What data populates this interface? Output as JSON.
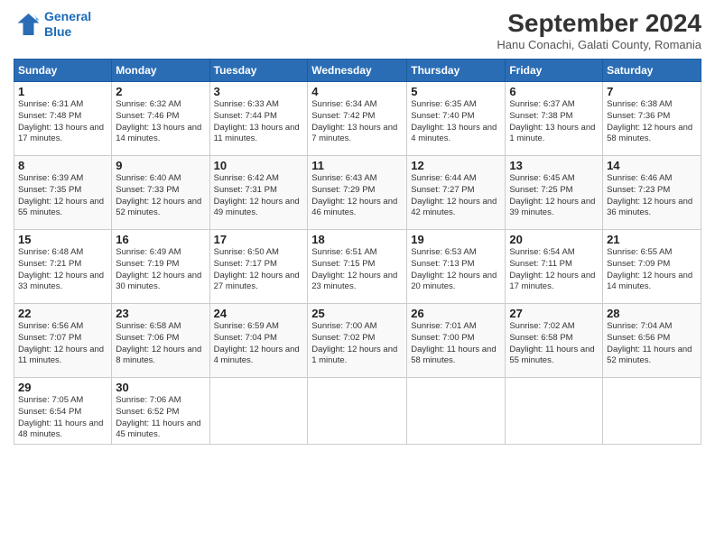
{
  "header": {
    "logo_line1": "General",
    "logo_line2": "Blue",
    "month_title": "September 2024",
    "subtitle": "Hanu Conachi, Galati County, Romania"
  },
  "weekdays": [
    "Sunday",
    "Monday",
    "Tuesday",
    "Wednesday",
    "Thursday",
    "Friday",
    "Saturday"
  ],
  "weeks": [
    [
      {
        "day": 1,
        "sunrise": "6:31 AM",
        "sunset": "7:48 PM",
        "daylight": "13 hours and 17 minutes."
      },
      {
        "day": 2,
        "sunrise": "6:32 AM",
        "sunset": "7:46 PM",
        "daylight": "13 hours and 14 minutes."
      },
      {
        "day": 3,
        "sunrise": "6:33 AM",
        "sunset": "7:44 PM",
        "daylight": "13 hours and 11 minutes."
      },
      {
        "day": 4,
        "sunrise": "6:34 AM",
        "sunset": "7:42 PM",
        "daylight": "13 hours and 7 minutes."
      },
      {
        "day": 5,
        "sunrise": "6:35 AM",
        "sunset": "7:40 PM",
        "daylight": "13 hours and 4 minutes."
      },
      {
        "day": 6,
        "sunrise": "6:37 AM",
        "sunset": "7:38 PM",
        "daylight": "13 hours and 1 minute."
      },
      {
        "day": 7,
        "sunrise": "6:38 AM",
        "sunset": "7:36 PM",
        "daylight": "12 hours and 58 minutes."
      }
    ],
    [
      {
        "day": 8,
        "sunrise": "6:39 AM",
        "sunset": "7:35 PM",
        "daylight": "12 hours and 55 minutes."
      },
      {
        "day": 9,
        "sunrise": "6:40 AM",
        "sunset": "7:33 PM",
        "daylight": "12 hours and 52 minutes."
      },
      {
        "day": 10,
        "sunrise": "6:42 AM",
        "sunset": "7:31 PM",
        "daylight": "12 hours and 49 minutes."
      },
      {
        "day": 11,
        "sunrise": "6:43 AM",
        "sunset": "7:29 PM",
        "daylight": "12 hours and 46 minutes."
      },
      {
        "day": 12,
        "sunrise": "6:44 AM",
        "sunset": "7:27 PM",
        "daylight": "12 hours and 42 minutes."
      },
      {
        "day": 13,
        "sunrise": "6:45 AM",
        "sunset": "7:25 PM",
        "daylight": "12 hours and 39 minutes."
      },
      {
        "day": 14,
        "sunrise": "6:46 AM",
        "sunset": "7:23 PM",
        "daylight": "12 hours and 36 minutes."
      }
    ],
    [
      {
        "day": 15,
        "sunrise": "6:48 AM",
        "sunset": "7:21 PM",
        "daylight": "12 hours and 33 minutes."
      },
      {
        "day": 16,
        "sunrise": "6:49 AM",
        "sunset": "7:19 PM",
        "daylight": "12 hours and 30 minutes."
      },
      {
        "day": 17,
        "sunrise": "6:50 AM",
        "sunset": "7:17 PM",
        "daylight": "12 hours and 27 minutes."
      },
      {
        "day": 18,
        "sunrise": "6:51 AM",
        "sunset": "7:15 PM",
        "daylight": "12 hours and 23 minutes."
      },
      {
        "day": 19,
        "sunrise": "6:53 AM",
        "sunset": "7:13 PM",
        "daylight": "12 hours and 20 minutes."
      },
      {
        "day": 20,
        "sunrise": "6:54 AM",
        "sunset": "7:11 PM",
        "daylight": "12 hours and 17 minutes."
      },
      {
        "day": 21,
        "sunrise": "6:55 AM",
        "sunset": "7:09 PM",
        "daylight": "12 hours and 14 minutes."
      }
    ],
    [
      {
        "day": 22,
        "sunrise": "6:56 AM",
        "sunset": "7:07 PM",
        "daylight": "12 hours and 11 minutes."
      },
      {
        "day": 23,
        "sunrise": "6:58 AM",
        "sunset": "7:06 PM",
        "daylight": "12 hours and 8 minutes."
      },
      {
        "day": 24,
        "sunrise": "6:59 AM",
        "sunset": "7:04 PM",
        "daylight": "12 hours and 4 minutes."
      },
      {
        "day": 25,
        "sunrise": "7:00 AM",
        "sunset": "7:02 PM",
        "daylight": "12 hours and 1 minute."
      },
      {
        "day": 26,
        "sunrise": "7:01 AM",
        "sunset": "7:00 PM",
        "daylight": "11 hours and 58 minutes."
      },
      {
        "day": 27,
        "sunrise": "7:02 AM",
        "sunset": "6:58 PM",
        "daylight": "11 hours and 55 minutes."
      },
      {
        "day": 28,
        "sunrise": "7:04 AM",
        "sunset": "6:56 PM",
        "daylight": "11 hours and 52 minutes."
      }
    ],
    [
      {
        "day": 29,
        "sunrise": "7:05 AM",
        "sunset": "6:54 PM",
        "daylight": "11 hours and 48 minutes."
      },
      {
        "day": 30,
        "sunrise": "7:06 AM",
        "sunset": "6:52 PM",
        "daylight": "11 hours and 45 minutes."
      },
      null,
      null,
      null,
      null,
      null
    ]
  ]
}
